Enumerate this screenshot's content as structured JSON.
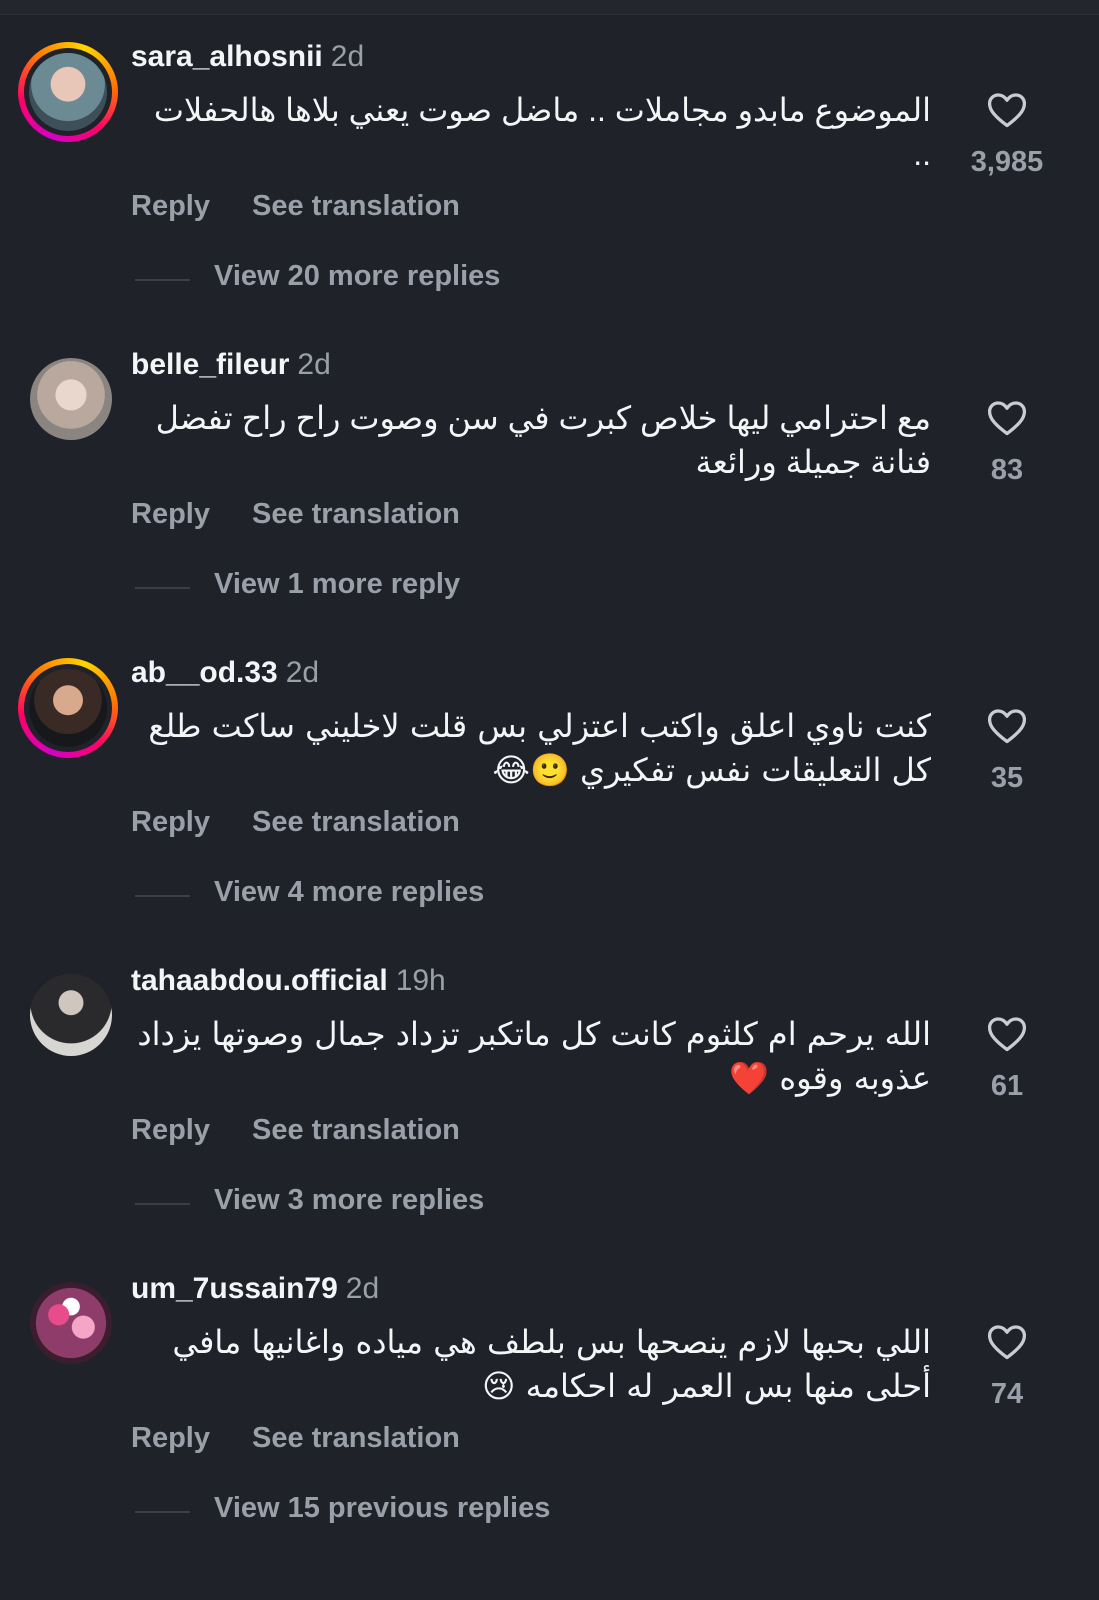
{
  "comments": [
    {
      "username": "sara_alhosnii",
      "time": "2d",
      "text": "الموضوع مابدو مجاملات .. ماضل صوت يعني بلاها هالحفلات ..",
      "likes": "3,985",
      "reply_label": "Reply",
      "translate_label": "See translation",
      "view_replies": "View 20 more replies",
      "story_ring": true
    },
    {
      "username": "belle_fileur",
      "time": "2d",
      "text": "مع احترامي ليها خلاص كبرت في سن وصوت راح راح تفضل فنانة جميلة ورائعة",
      "likes": "83",
      "reply_label": "Reply",
      "translate_label": "See translation",
      "view_replies": "View 1 more reply",
      "story_ring": false
    },
    {
      "username": "ab__od.33",
      "time": "2d",
      "text": "كنت ناوي اعلق واكتب اعتزلي بس قلت لاخليني ساكت طلع كل التعليقات نفس تفكيري 🙂😂",
      "likes": "35",
      "reply_label": "Reply",
      "translate_label": "See translation",
      "view_replies": "View 4 more replies",
      "story_ring": true
    },
    {
      "username": "tahaabdou.official",
      "time": "19h",
      "text": "الله يرحم ام كلثوم كانت كل ماتكبر تزداد جمال وصوتها يزداد عذوبه وقوه ❤️",
      "likes": "61",
      "reply_label": "Reply",
      "translate_label": "See translation",
      "view_replies": "View 3 more replies",
      "story_ring": false
    },
    {
      "username": "um_7ussain79",
      "time": "2d",
      "text": "اللي بحبها لازم ينصحها بس بلطف هي مياده واغانيها مافي أحلى منها بس العمر له احكامه 😢",
      "likes": "74",
      "reply_label": "Reply",
      "translate_label": "See translation",
      "view_replies": "View 15 previous replies",
      "story_ring": false
    }
  ],
  "icons": {
    "like": "heart-outline-icon"
  },
  "colors": {
    "background": "#1f2229",
    "primary_text": "#f4f5f7",
    "secondary_text": "#9aa0aa"
  }
}
